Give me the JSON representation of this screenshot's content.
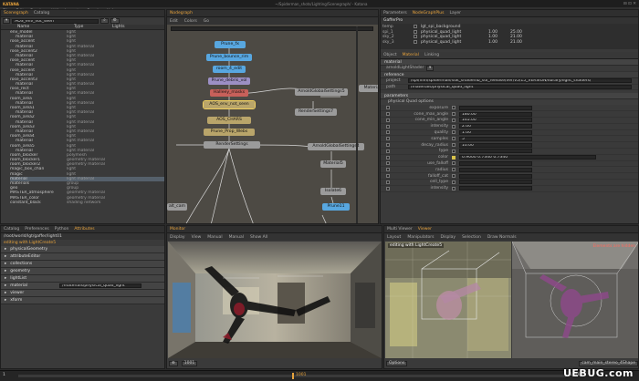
{
  "window": {
    "title": "~/Spiderman_shots/Lighting/Scenegraph/ - Katana",
    "logo": "KATANA"
  },
  "menu": [
    "File",
    "Edit",
    "Render",
    "Util",
    "Layouts",
    "Panels",
    "Help"
  ],
  "scenegraph": {
    "tabs": [
      "Scenegraph",
      "Catalog"
    ],
    "columns": [
      "Name",
      "Type",
      "Lights"
    ],
    "path_value": "AOS_env_not_seen",
    "rows": [
      {
        "name": "env_model",
        "type": "light"
      },
      {
        "name": "material",
        "type": "light"
      },
      {
        "name": "rose_accent",
        "type": "light"
      },
      {
        "name": "material",
        "type": "light material"
      },
      {
        "name": "rose_accent2",
        "type": "light"
      },
      {
        "name": "material",
        "type": "light material"
      },
      {
        "name": "rose_accent",
        "type": "light"
      },
      {
        "name": "material",
        "type": "light material"
      },
      {
        "name": "rose_accent",
        "type": "light"
      },
      {
        "name": "material",
        "type": "light material"
      },
      {
        "name": "rose_accent3",
        "type": "light"
      },
      {
        "name": "material",
        "type": "light material"
      },
      {
        "name": "rose_rect",
        "type": "light"
      },
      {
        "name": "material",
        "type": "light material"
      },
      {
        "name": "room_area",
        "type": "light"
      },
      {
        "name": "material",
        "type": "light material"
      },
      {
        "name": "room_area1",
        "type": "light"
      },
      {
        "name": "material",
        "type": "light material"
      },
      {
        "name": "room_area2",
        "type": "light"
      },
      {
        "name": "material",
        "type": "light material"
      },
      {
        "name": "room_area3",
        "type": "light"
      },
      {
        "name": "material",
        "type": "light material"
      },
      {
        "name": "room_area4",
        "type": "light"
      },
      {
        "name": "material",
        "type": "light material"
      },
      {
        "name": "room_area5",
        "type": "light"
      },
      {
        "name": "material",
        "type": "light material"
      },
      {
        "name": "room_blocker",
        "type": "polymesh"
      },
      {
        "name": "room_blocker1",
        "type": "geometry material"
      },
      {
        "name": "room_blocker2",
        "type": "geometry material"
      },
      {
        "name": "magic_box_chan",
        "type": "light"
      },
      {
        "name": "magic",
        "type": "light"
      },
      {
        "name": "material",
        "type": "light material"
      },
      {
        "name": "materials",
        "type": "group"
      },
      {
        "name": "geo",
        "type": "group"
      },
      {
        "name": "MASTER_atmosphere",
        "type": "geometry material"
      },
      {
        "name": "MASTER_color",
        "type": "geometry material"
      },
      {
        "name": "constant_black",
        "type": "shading network"
      }
    ],
    "selected_index": 31
  },
  "nodegraph": {
    "tab": "Nodegraph",
    "menu": [
      "Edit",
      "Colors",
      "Go"
    ],
    "nodes": [
      {
        "label": "Prune_fx",
        "kind": "blue"
      },
      {
        "label": "Prune_bounce_rim",
        "kind": "blue"
      },
      {
        "label": "room_4_edit",
        "kind": "blue"
      },
      {
        "label": "Prune_debris_vol",
        "kind": "purple"
      },
      {
        "label": "Halleey_masks",
        "kind": "red"
      },
      {
        "label": "AOS_env_not_seen",
        "kind": "tan"
      },
      {
        "label": "ArnoldGlobalSettings5",
        "kind": "grey"
      },
      {
        "label": "Material",
        "kind": "grey"
      },
      {
        "label": "RenderSettings7",
        "kind": "grey"
      },
      {
        "label": "AOS_CHARS",
        "kind": "tan"
      },
      {
        "label": "Prune_Prop_Webs",
        "kind": "tan"
      },
      {
        "label": "RenderSettings",
        "kind": "grey"
      },
      {
        "label": "ArnoldGlobalSettings4",
        "kind": "grey"
      },
      {
        "label": "Material5",
        "kind": "grey"
      },
      {
        "label": "Isolate6",
        "kind": "grey"
      },
      {
        "label": "Prune11",
        "kind": "blue"
      },
      {
        "label": "alt_cam",
        "kind": "grey"
      }
    ]
  },
  "parameters": {
    "tabs": [
      "Parameters",
      "NodeGraphPlus",
      "Layer"
    ],
    "active_tab": "NodeGraphPlus",
    "header": "GafferPro",
    "list_rows": [
      {
        "name": "lgt_spi_background",
        "c1": "",
        "c2": ""
      },
      {
        "name": "physical_quad_light",
        "c1": "1.00",
        "c2": "25.00"
      },
      {
        "name": "physical_quad_light",
        "c1": "1.00",
        "c2": "21.00"
      },
      {
        "name": "physical_quad_light",
        "c1": "1.00",
        "c2": "21.00"
      }
    ],
    "list_names": [
      "temp",
      "spi_1",
      "sky_2",
      "sky_3"
    ],
    "subtabs": [
      "Object",
      "Material",
      "Linking"
    ],
    "section_material": "material",
    "shader_label": "arnoldLightShader",
    "reference_label": "reference",
    "project_label": "project",
    "project_value": "/spi/film/spiderman/sdk_shaderlib_sdl_release/ver/v5/15_VERSION/library/light_shaders/",
    "path_label": "path",
    "path_value": "/materials/physical_quad_light",
    "param_section": "parameters",
    "param_group": "physical Quad options",
    "param_rows": [
      {
        "label": "exposure",
        "value": ""
      },
      {
        "label": "cone_max_angle",
        "value": "180.00"
      },
      {
        "label": "cone_min_angle",
        "value": "165.00"
      },
      {
        "label": "intensity",
        "value": "2.00"
      },
      {
        "label": "quality",
        "value": "1.00"
      },
      {
        "label": "samples",
        "value": "5"
      },
      {
        "label": "decay_radius",
        "value": "10.00"
      },
      {
        "label": "type",
        "value": ""
      },
      {
        "label": "color",
        "value": "0.9000   0.7340   0.7340"
      },
      {
        "label": "use_falloff",
        "value": ""
      },
      {
        "label": "radius",
        "value": ""
      },
      {
        "label": "falloff_cat",
        "value": ""
      },
      {
        "label": "cell_type",
        "value": ""
      },
      {
        "label": "intensity",
        "value": ""
      }
    ]
  },
  "attributes": {
    "tabs": [
      "Catalog",
      "Preferences",
      "Python",
      "Attributes"
    ],
    "path": "/root/world/lgt/gaffer/light01",
    "subtitle": "editing with LightCreate5",
    "rows": [
      "light",
      "physicalProperties",
      "geometry",
      "arnold",
      "color",
      "timing",
      "spatial",
      "xform",
      "curves",
      "color",
      "viewer"
    ],
    "sections": [
      "physicalGeometry",
      "attributeEditor",
      "collections",
      "geometry",
      "lightList",
      "material",
      "viewer",
      "xform"
    ],
    "material_value": "/materials/physical_quad_light",
    "field_value": "/root/world/lgt/gaffer/light01"
  },
  "monitor": {
    "tab": "Monitor",
    "controls": [
      "Display",
      "View",
      "Manual",
      "Manual",
      "Show All"
    ],
    "frame_label": "1001"
  },
  "viewer": {
    "tabs": [
      "Multi Viewer",
      "Viewer"
    ],
    "menu": [
      "Layout",
      "Manipulators",
      "Display",
      "Selection",
      "Draw Normals"
    ],
    "label": "editing with LightCreate5",
    "overlay": "Elements are hidden",
    "bottom_left": "Options",
    "bottom_right": "cam_main_stereo_4Shape"
  },
  "timeline": {
    "start": "1",
    "end": "1048",
    "current": "1001"
  },
  "watermark": "UEBUG.com",
  "colors": {
    "accent": "#e8a33c",
    "selection": "#55606b",
    "node_blue": "#58a7e0"
  }
}
